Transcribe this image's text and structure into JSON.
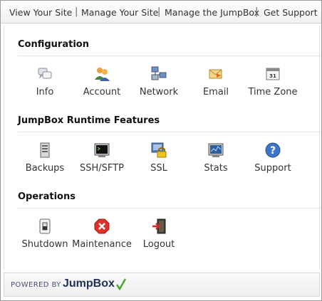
{
  "topnav": {
    "links": [
      "View Your Site",
      "Manage Your Site",
      "Manage the JumpBox",
      "Get Support"
    ],
    "separator": "|"
  },
  "sections": {
    "configuration": {
      "title": "Configuration",
      "items": [
        {
          "label": "Info",
          "icon": "info-icon"
        },
        {
          "label": "Account",
          "icon": "account-icon"
        },
        {
          "label": "Network",
          "icon": "network-icon"
        },
        {
          "label": "Email",
          "icon": "email-icon"
        },
        {
          "label": "Time Zone",
          "icon": "calendar-icon"
        }
      ]
    },
    "runtime": {
      "title": "JumpBox Runtime Features",
      "items": [
        {
          "label": "Backups",
          "icon": "backups-icon"
        },
        {
          "label": "SSH/SFTP",
          "icon": "terminal-icon"
        },
        {
          "label": "SSL",
          "icon": "ssl-lock-icon"
        },
        {
          "label": "Stats",
          "icon": "stats-icon"
        },
        {
          "label": "Support",
          "icon": "help-icon"
        }
      ]
    },
    "operations": {
      "title": "Operations",
      "items": [
        {
          "label": "Shutdown",
          "icon": "power-switch-icon"
        },
        {
          "label": "Maintenance",
          "icon": "stop-icon"
        },
        {
          "label": "Logout",
          "icon": "logout-door-icon"
        }
      ]
    }
  },
  "calendar_icon_day": "31",
  "footer": {
    "powered_by": "POWERED BY",
    "brand": "JumpBox"
  }
}
